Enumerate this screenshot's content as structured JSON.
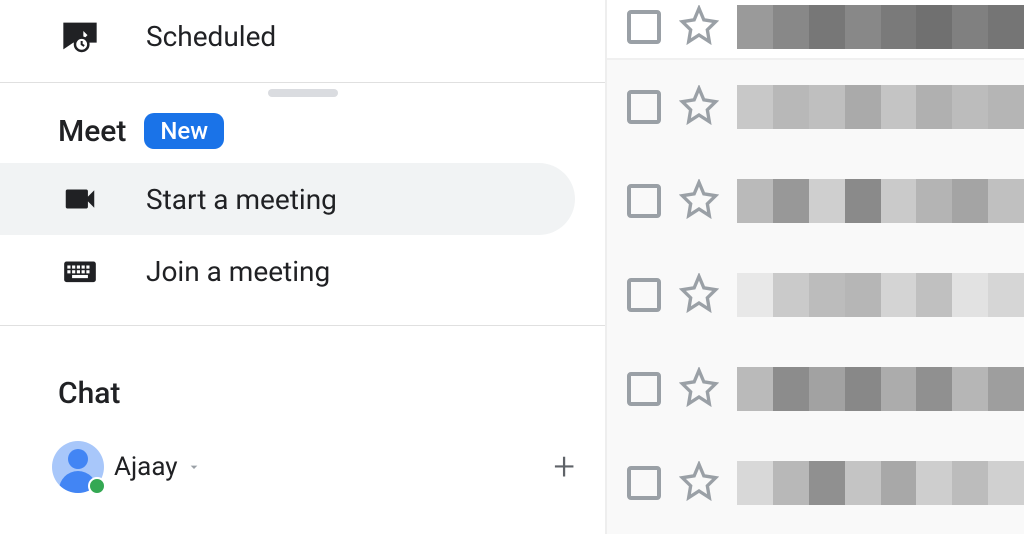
{
  "sidebar": {
    "scheduled_label": "Scheduled",
    "meet_header": "Meet",
    "meet_badge": "New",
    "start_meeting_label": "Start a meeting",
    "join_meeting_label": "Join a meeting",
    "chat_header": "Chat",
    "chat_user": "Ajaay"
  },
  "email_rows": 6
}
